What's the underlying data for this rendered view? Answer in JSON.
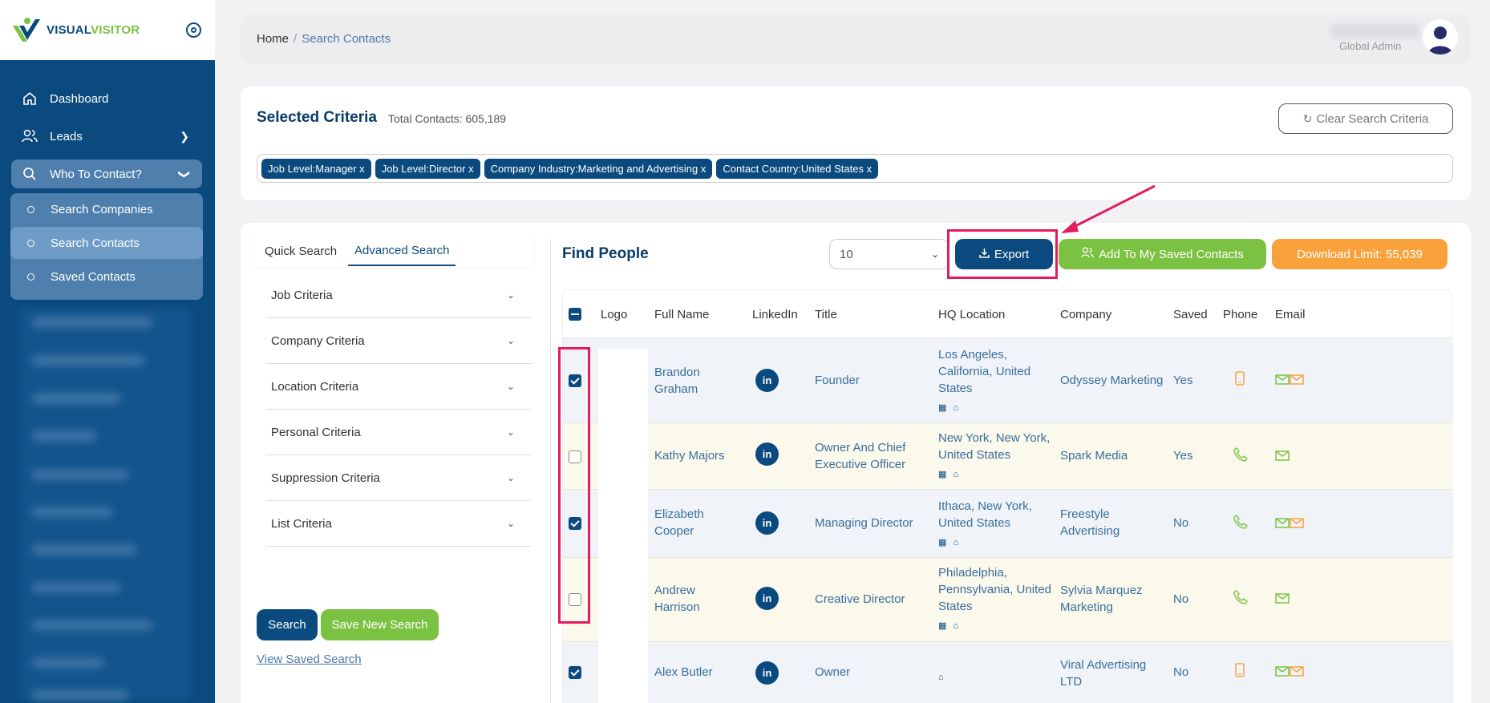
{
  "brand": {
    "name_part1": "VISUAL",
    "name_part2": "VISITOR"
  },
  "sidebar": {
    "items": [
      {
        "label": "Dashboard"
      },
      {
        "label": "Leads"
      },
      {
        "label": "Who To Contact?"
      }
    ],
    "sub_items": [
      {
        "label": "Search Companies"
      },
      {
        "label": "Search Contacts"
      },
      {
        "label": "Saved Contacts"
      }
    ]
  },
  "header": {
    "breadcrumb_home": "Home",
    "breadcrumb_sep": "/",
    "breadcrumb_current": "Search Contacts",
    "user_role": "Global Admin"
  },
  "criteria": {
    "title": "Selected Criteria",
    "total": "Total Contacts: 605,189",
    "clear_label": "Clear Search Criteria",
    "chips": [
      "Job Level:Manager x",
      "Job Level:Director x",
      "Company Industry:Marketing and Advertising x",
      "Contact Country:United States x"
    ]
  },
  "search": {
    "tabs": [
      "Quick Search",
      "Advanced Search"
    ],
    "sections": [
      "Job Criteria",
      "Company Criteria",
      "Location Criteria",
      "Personal Criteria",
      "Suppression Criteria",
      "List Criteria"
    ],
    "search_label": "Search",
    "save_label": "Save New Search",
    "view_saved_label": "View Saved Search"
  },
  "results": {
    "title": "Find People",
    "page_size": "10",
    "export_label": "Export",
    "add_label": "Add To My Saved Contacts",
    "limit_label": "Download Limit: 55,039",
    "columns": [
      "Logo",
      "Full Name",
      "LinkedIn",
      "Title",
      "HQ Location",
      "Company",
      "Saved",
      "Phone",
      "Email"
    ],
    "linkedin_glyph": "in",
    "rows": [
      {
        "checked": true,
        "name": "Brandon Graham",
        "title": "Founder",
        "hq": "Los Angeles, California, United States",
        "company": "Odyssey Marketing",
        "saved": "Yes",
        "phone": "mobile",
        "email": "both",
        "bg": "#f0f4f8"
      },
      {
        "checked": false,
        "name": "Kathy Majors",
        "title": "Owner And Chief Executive Officer",
        "hq": "New York, New York, United States",
        "company": "Spark Media",
        "saved": "Yes",
        "phone": "office",
        "email": "green",
        "bg": "#fbf8ec"
      },
      {
        "checked": true,
        "name": "Elizabeth Cooper",
        "title": "Managing Director",
        "hq": "Ithaca, New York, United States",
        "company": "Freestyle Advertising",
        "saved": "No",
        "phone": "office",
        "email": "both",
        "bg": "#f0f4f8"
      },
      {
        "checked": false,
        "name": "Andrew Harrison",
        "title": "Creative Director",
        "hq": "Philadelphia, Pennsylvania, United States",
        "company": "Sylvia Marquez Marketing",
        "saved": "No",
        "phone": "office",
        "email": "green",
        "bg": "#fbf8ec"
      },
      {
        "checked": true,
        "name": "Alex Butler",
        "title": "Owner",
        "hq": "",
        "company": "Viral Advertising LTD",
        "saved": "No",
        "phone": "mobile",
        "email": "both",
        "bg": "#f0f4f8"
      }
    ]
  },
  "colors": {
    "primary": "#0b4a7e",
    "green": "#7cc242",
    "orange": "#f9a23b",
    "highlight": "#e31c5f"
  }
}
